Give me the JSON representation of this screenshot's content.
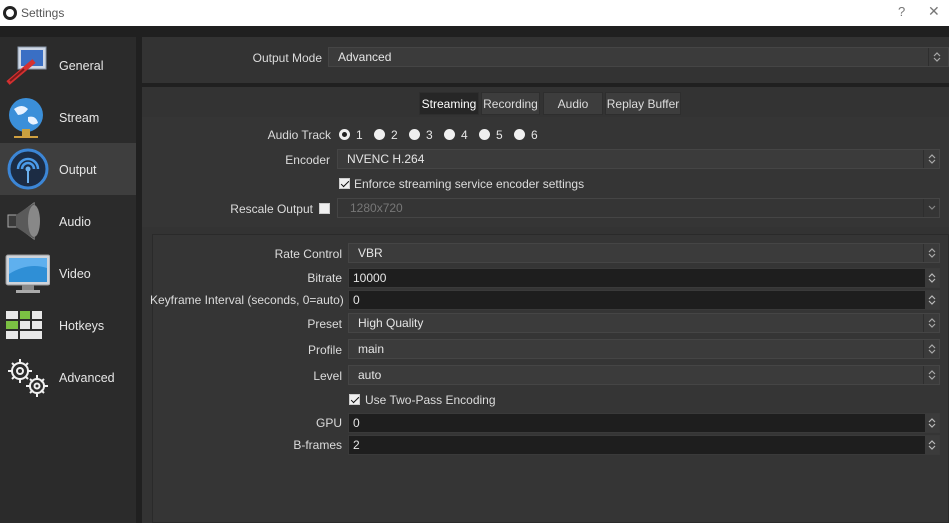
{
  "window": {
    "title": "Settings",
    "help": "?",
    "close": "✕"
  },
  "sidebar": {
    "items": [
      {
        "label": "General",
        "icon": "general-icon"
      },
      {
        "label": "Stream",
        "icon": "stream-globe-icon"
      },
      {
        "label": "Output",
        "icon": "output-broadcast-icon",
        "active": true
      },
      {
        "label": "Audio",
        "icon": "speaker-icon"
      },
      {
        "label": "Video",
        "icon": "monitor-icon"
      },
      {
        "label": "Hotkeys",
        "icon": "keyboard-icon"
      },
      {
        "label": "Advanced",
        "icon": "gears-icon"
      }
    ]
  },
  "output_mode": {
    "label": "Output Mode",
    "value": "Advanced"
  },
  "tabs": [
    {
      "label": "Streaming",
      "active": true
    },
    {
      "label": "Recording"
    },
    {
      "label": "Audio"
    },
    {
      "label": "Replay Buffer"
    }
  ],
  "streaming": {
    "audio_track": {
      "label": "Audio Track",
      "options": [
        "1",
        "2",
        "3",
        "4",
        "5",
        "6"
      ],
      "selected": "1"
    },
    "encoder": {
      "label": "Encoder",
      "value": "NVENC H.264"
    },
    "enforce": {
      "label": "Enforce streaming service encoder settings",
      "checked": true
    },
    "rescale": {
      "label": "Rescale Output",
      "checked": false,
      "value": "1280x720"
    }
  },
  "encoder_settings": {
    "rate_control": {
      "label": "Rate Control",
      "value": "VBR"
    },
    "bitrate": {
      "label": "Bitrate",
      "value": "10000"
    },
    "keyframe": {
      "label": "Keyframe Interval (seconds, 0=auto)",
      "value": "0"
    },
    "preset": {
      "label": "Preset",
      "value": "High Quality"
    },
    "profile": {
      "label": "Profile",
      "value": "main"
    },
    "level": {
      "label": "Level",
      "value": "auto"
    },
    "two_pass": {
      "label": "Use Two-Pass Encoding",
      "checked": true
    },
    "gpu": {
      "label": "GPU",
      "value": "0"
    },
    "bframes": {
      "label": "B-frames",
      "value": "2"
    }
  }
}
